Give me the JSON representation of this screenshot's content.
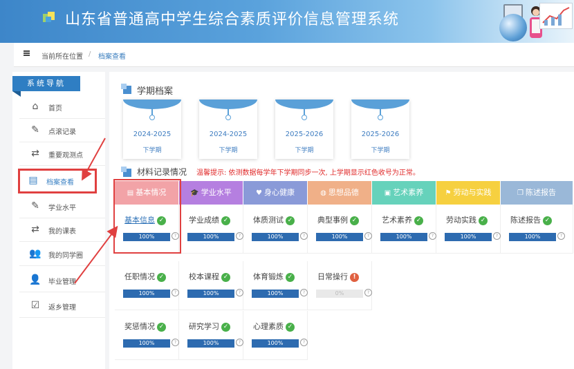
{
  "header": {
    "title": "山东省普通高中学生综合素质评价信息管理系统"
  },
  "breadcrumb": {
    "location_label": "当前所在位置",
    "current": "档案查看"
  },
  "sidebar": {
    "title": "系统导航",
    "items": [
      {
        "label": "首页",
        "icon": "home-icon"
      },
      {
        "label": "点滚记录",
        "icon": "edit-icon"
      },
      {
        "label": "重要观测点",
        "icon": "swap-icon"
      },
      {
        "label": "档案查看",
        "icon": "archive-icon"
      },
      {
        "label": "学业水平",
        "icon": "edit-icon"
      },
      {
        "label": "我的课表",
        "icon": "swap-icon"
      },
      {
        "label": "我的同学圈",
        "icon": "users-icon"
      },
      {
        "label": "毕业管理",
        "icon": "user-icon"
      },
      {
        "label": "返乡管理",
        "icon": "clipboard-check-icon"
      }
    ]
  },
  "terms": {
    "title": "学期档案",
    "cards": [
      {
        "year": "2024-2025",
        "semester": "下学期"
      },
      {
        "year": "2024-2025",
        "semester": "下学期"
      },
      {
        "year": "2025-2026",
        "semester": "下学期"
      },
      {
        "year": "2025-2026",
        "semester": "下学期"
      }
    ]
  },
  "materials": {
    "title": "材料记录情况",
    "warning": "温馨提示: 依测数据每学年下学期同步一次, 上学期显示红色收号为正常。",
    "categories": [
      {
        "label": "基本情况",
        "color": "#f2a3a7",
        "icon": "document-icon"
      },
      {
        "label": "学业水平",
        "color": "#b57fe0",
        "icon": "graduation-icon"
      },
      {
        "label": "身心健康",
        "color": "#8a9ad8",
        "icon": "heart-icon"
      },
      {
        "label": "思想品德",
        "color": "#f0b088",
        "icon": "globe-icon"
      },
      {
        "label": "艺术素养",
        "color": "#66d2bb",
        "icon": "image-icon"
      },
      {
        "label": "劳动与实践",
        "color": "#f6d040",
        "icon": "flag-icon"
      },
      {
        "label": "陈述报告",
        "color": "#9ab8d8",
        "icon": "copy-icon"
      }
    ],
    "rows": [
      [
        {
          "name": "基本信息",
          "status": "ok",
          "progress": 100,
          "pct_label": "100%"
        },
        {
          "name": "学业成绩",
          "status": "ok",
          "progress": 100,
          "pct_label": "100%"
        },
        {
          "name": "体质测试",
          "status": "ok",
          "progress": 100,
          "pct_label": "100%"
        },
        {
          "name": "典型事例",
          "status": "ok",
          "progress": 100,
          "pct_label": "100%"
        },
        {
          "name": "艺术素养",
          "status": "ok",
          "progress": 100,
          "pct_label": "100%"
        },
        {
          "name": "劳动实践",
          "status": "ok",
          "progress": 100,
          "pct_label": "100%"
        },
        {
          "name": "陈述报告",
          "status": "ok",
          "progress": 100,
          "pct_label": "100%"
        }
      ],
      [
        {
          "name": "任职情况",
          "status": "ok",
          "progress": 100,
          "pct_label": "100%"
        },
        {
          "name": "校本课程",
          "status": "ok",
          "progress": 100,
          "pct_label": "100%"
        },
        {
          "name": "体育锻炼",
          "status": "ok",
          "progress": 100,
          "pct_label": "100%"
        },
        {
          "name": "日常操行",
          "status": "warn",
          "progress": 0,
          "pct_label": "0%"
        }
      ],
      [
        {
          "name": "奖惩情况",
          "status": "ok",
          "progress": 100,
          "pct_label": "100%"
        },
        {
          "name": "研究学习",
          "status": "ok",
          "progress": 100,
          "pct_label": "100%"
        },
        {
          "name": "心理素质",
          "status": "ok",
          "progress": 100,
          "pct_label": "100%"
        }
      ]
    ]
  }
}
